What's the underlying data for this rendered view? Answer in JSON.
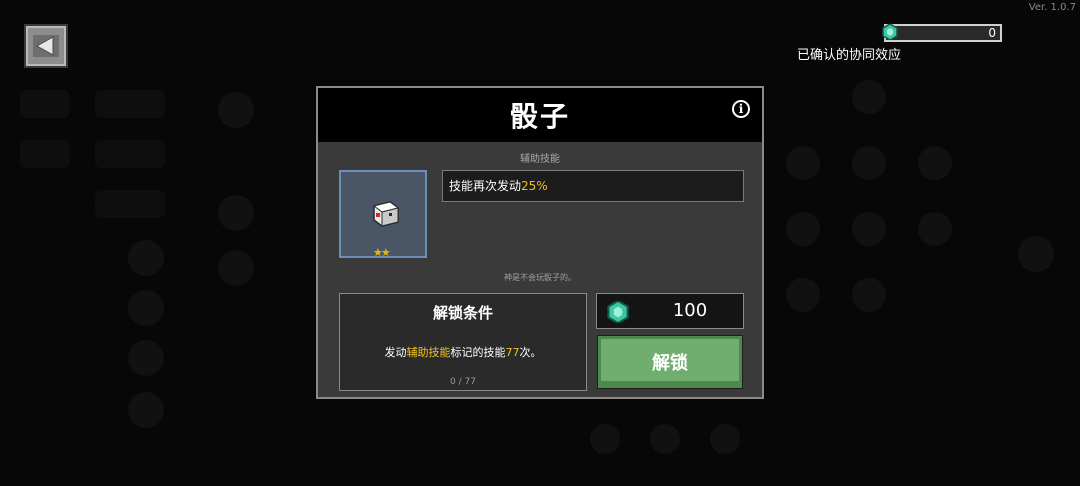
{
  "version": "Ver. 1.0.7",
  "top_bar": {
    "gem_count": "0",
    "gem_icon": "green-gem-icon",
    "synergy_label": "已确认的协同效应"
  },
  "modal": {
    "title": "骰子",
    "category": "辅助技能",
    "item": {
      "icon": "dice-icon",
      "stars": "★★",
      "star_color": "#f0b400"
    },
    "effect": {
      "prefix": "技能再次发动",
      "value": "25%"
    },
    "flavor_text": "神是不会玩骰子的。",
    "unlock_condition": {
      "title": "解锁条件",
      "desc_pre": "发动",
      "desc_hl1": "辅助技能",
      "desc_mid": "标记的技能",
      "desc_hl2": "77",
      "desc_post": "次。",
      "progress": "0 / 77"
    },
    "cost": "100",
    "unlock_button": "解锁"
  },
  "colors": {
    "highlight": "#f2c025",
    "button_green": "#6fae6f",
    "gem": "#3fc7a0"
  }
}
